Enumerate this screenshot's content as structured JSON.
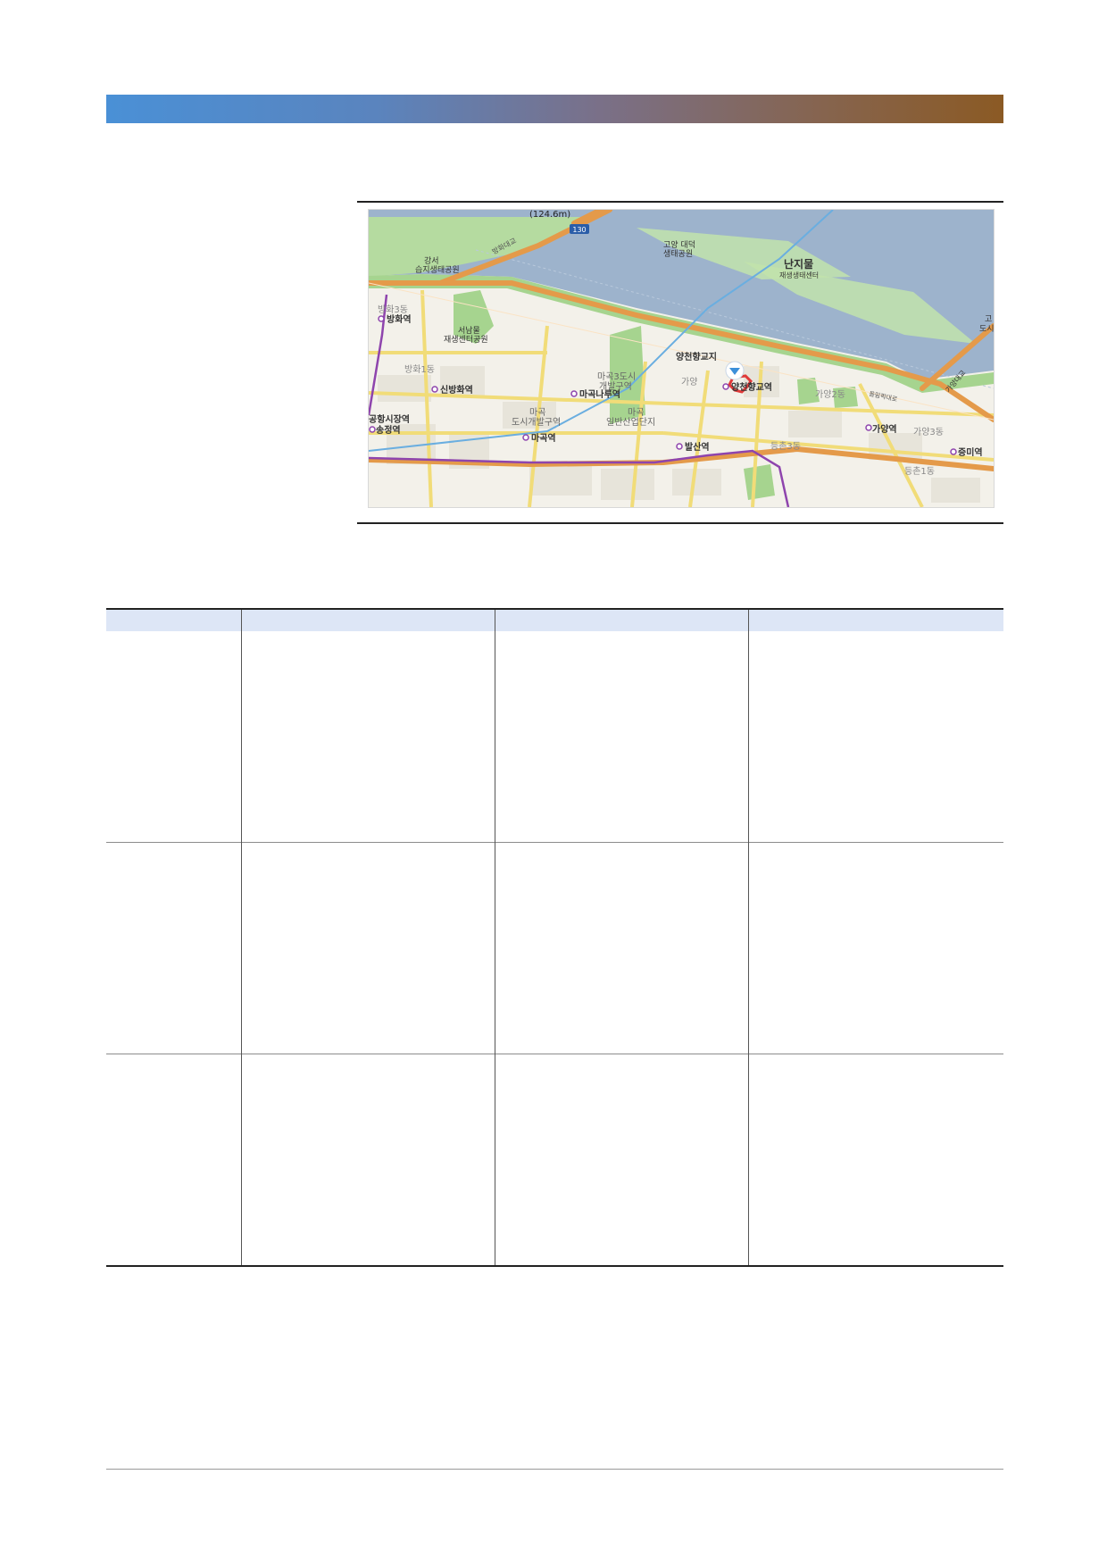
{
  "colors": {
    "header_band_start": "#4a90d6",
    "header_band_end": "#8b5a24",
    "river": "#9db3cc",
    "land": "#f3f1ea",
    "park": "#a6d48f",
    "highway": "#e49a4a",
    "road": "#f1dc78",
    "subway_line": "#8e44ad",
    "location_marker": "#3c8fd9",
    "area_outline": "#e03a3a",
    "table_header_bg": "#dde6f6"
  },
  "map": {
    "scale_label": "(124.6m)",
    "highway_shield": "130",
    "marker_icon": "location-pin-icon",
    "labels": {
      "bridge_banghwa": "방화대교",
      "gangseo_park_line1": "강서",
      "gangseo_park_line2": "습지생태공원",
      "goyang_park_line1": "고양 대덕",
      "goyang_park_line2": "생태공원",
      "nanjimul_line1": "난지물",
      "nanjimul_line2": "재생생태센터",
      "top_right_line1": "고",
      "top_right_line2": "도시",
      "banghwa3": "방화3동",
      "banghwa_station": "방화역",
      "seonamul_line1": "서남물",
      "seonamul_line2": "재생센터공원",
      "banghwa1": "방화1동",
      "sinbanghwa_station": "신방화역",
      "magoknaru_station": "마곡나루역",
      "magok3_line1": "마곡3도시",
      "magok3_line2": "개발구역",
      "gayang_label": "가양",
      "yanggwon": "양천향교지",
      "yanggwon_station": "양천향교역",
      "gayang2": "가양2동",
      "expressway_olympic": "올림픽대로",
      "gayang_bridge": "가양대교",
      "gonghang_market_station": "공항시장역",
      "magok_dev_line1": "마곡",
      "magok_dev_line2": "도시개발구역",
      "magok_industrial_line1": "마곡",
      "magok_industrial_line2": "일반산업단지",
      "gayang_station": "가양역",
      "gayang3": "가양3동",
      "songjeong_station": "송정역",
      "magok_station": "마곡역",
      "balsan_station": "발산역",
      "deungchon3": "등촌3동",
      "jeungmi_station": "증미역",
      "deungchon1": "등촌1동"
    }
  },
  "table": {
    "headers": [
      "",
      "",
      "",
      ""
    ],
    "rows": [
      [
        "",
        "",
        "",
        ""
      ],
      [
        "",
        "",
        "",
        ""
      ],
      [
        "",
        "",
        "",
        ""
      ]
    ]
  }
}
